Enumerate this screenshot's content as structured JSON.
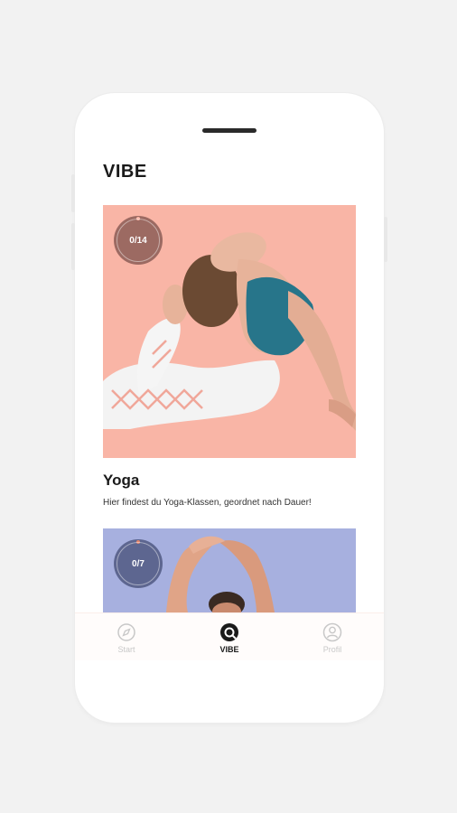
{
  "app": {
    "title": "VIBE"
  },
  "cards": [
    {
      "progress": "0/14",
      "title": "Yoga",
      "description": "Hier findest du Yoga-Klassen, geordnet nach Dauer!",
      "color": "#f9b5a6"
    },
    {
      "progress": "0/7",
      "color": "#a7b0df"
    }
  ],
  "tabbar": {
    "items": [
      {
        "label": "Start",
        "icon": "compass-icon",
        "active": false
      },
      {
        "label": "VIBE",
        "icon": "vibe-icon",
        "active": true
      },
      {
        "label": "Profil",
        "icon": "user-icon",
        "active": false
      }
    ]
  }
}
